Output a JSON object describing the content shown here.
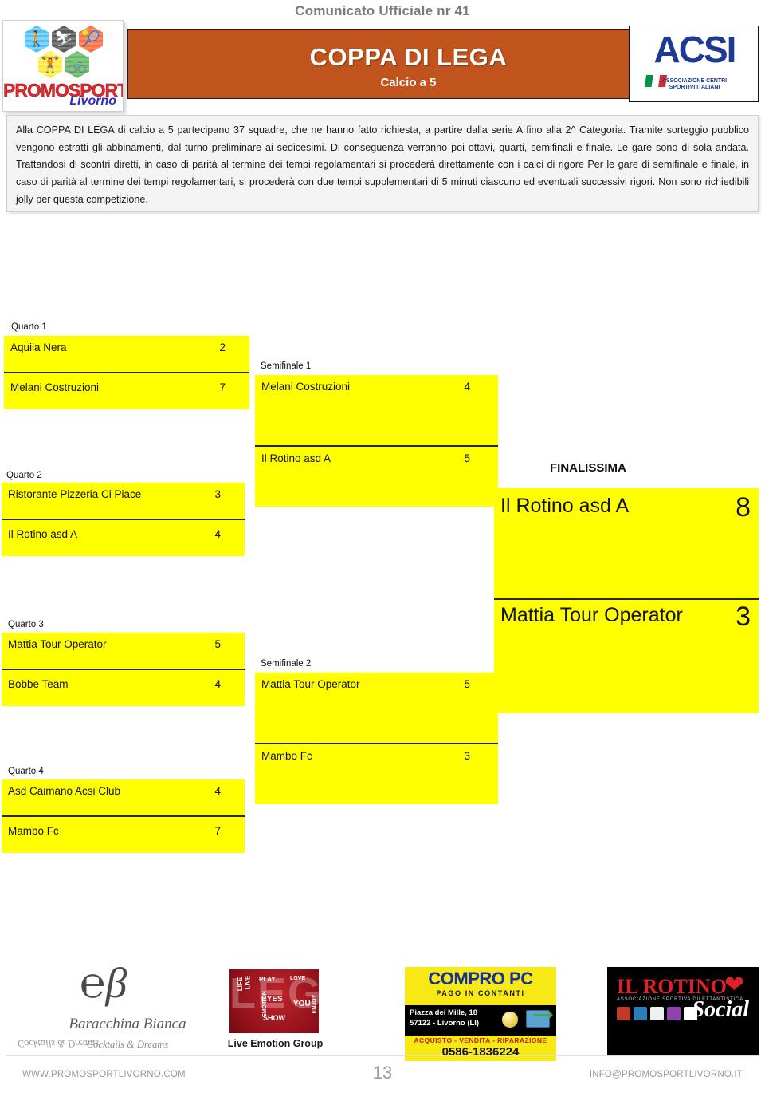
{
  "header": {
    "communique": "Comunicato Ufficiale nr 41",
    "title": "COPPA DI LEGA",
    "subtitle": "Calcio a 5",
    "left_logo": {
      "word": "PROMOSPORT",
      "city": "Livorno"
    },
    "right_logo": {
      "acronym": "ACSI",
      "line1": "ASSOCIAZIONE CENTRI",
      "line2": "SPORTIVI ITALIANI"
    }
  },
  "intro": {
    "text": "Alla COPPA DI LEGA di calcio a 5 partecipano 37 squadre, che ne hanno fatto richiesta, a partire dalla serie A fino alla 2^ Categoria. Tramite sorteggio pubblico vengono estratti gli abbinamenti, dal turno preliminare ai sedicesimi. Di conseguenza verranno poi ottavi, quarti, semifinali e finale. Le gare sono di sola andata. Trattandosi di scontri diretti, in caso di parità al termine dei tempi regolamentari si procederà direttamente con i calci di rigore Per le gare di semifinale e finale, in caso di parità al termine dei tempi regolamentari, si procederà con due tempi supplementari di 5 minuti ciascuno ed eventuali successivi rigori. Non sono richiedibili jolly per questa competizione."
  },
  "bracket": {
    "accent_color": "#FFFF00",
    "quarters": [
      {
        "label": "Quarto 1",
        "home": "Aquila Nera",
        "home_score": "2",
        "away": "Melani Costruzioni",
        "away_score": "7"
      },
      {
        "label": "Quarto 2",
        "home": "Ristorante Pizzeria Ci Piace",
        "home_score": "3",
        "away": "Il Rotino asd A",
        "away_score": "4"
      },
      {
        "label": "Quarto 3",
        "home": "Mattia Tour Operator",
        "home_score": "5",
        "away": "Bobbe Team",
        "away_score": "4"
      },
      {
        "label": "Quarto 4",
        "home": "Asd Caimano Acsi Club",
        "home_score": "4",
        "away": "Mambo Fc",
        "away_score": "7"
      }
    ],
    "semifinals": [
      {
        "label": "Semifinale 1",
        "home": "Melani Costruzioni",
        "home_score": "4",
        "away": "Il Rotino asd A",
        "away_score": "5"
      },
      {
        "label": "Semifinale 2",
        "home": "Mattia Tour Operator",
        "home_score": "5",
        "away": "Mambo Fc",
        "away_score": "3"
      }
    ],
    "final": {
      "label": "FINALISSIMA",
      "home": "Il Rotino asd A",
      "home_score": "8",
      "away": "Mattia Tour Operator",
      "away_score": "3"
    }
  },
  "sponsors": {
    "baracchina": {
      "name": "Baracchina Bianca",
      "tagline": "Cocktails & Dreams"
    },
    "leg": {
      "mark": "LEG",
      "name": "Live Emotion Group",
      "words": [
        "PLAY",
        "LIVE",
        "EYES",
        "YOU",
        "SHOW",
        "EMOTION",
        "LIFE",
        "LOVE",
        "ENJOY"
      ]
    },
    "compro_pc": {
      "title": "COMPRO PC",
      "subtitle": "PAGO IN CONTANTI",
      "address1": "Piazza dei Mille, 18",
      "address2": "57122 - Livorno (LI)",
      "services": "ACQUISTO - VENDITA - RIPARAZIONE",
      "phone": "0586-1836224"
    },
    "rotino": {
      "name": "IL ROTINO",
      "script": "Social",
      "asd": "ASSOCIAZIONE SPORTIVA DILETTANTISTICA"
    }
  },
  "footer": {
    "website": "WWW.PROMOSPORTLIVORNO.COM",
    "page_number": "13",
    "email": "INFO@PROMOSPORTLIVORNO.IT"
  }
}
